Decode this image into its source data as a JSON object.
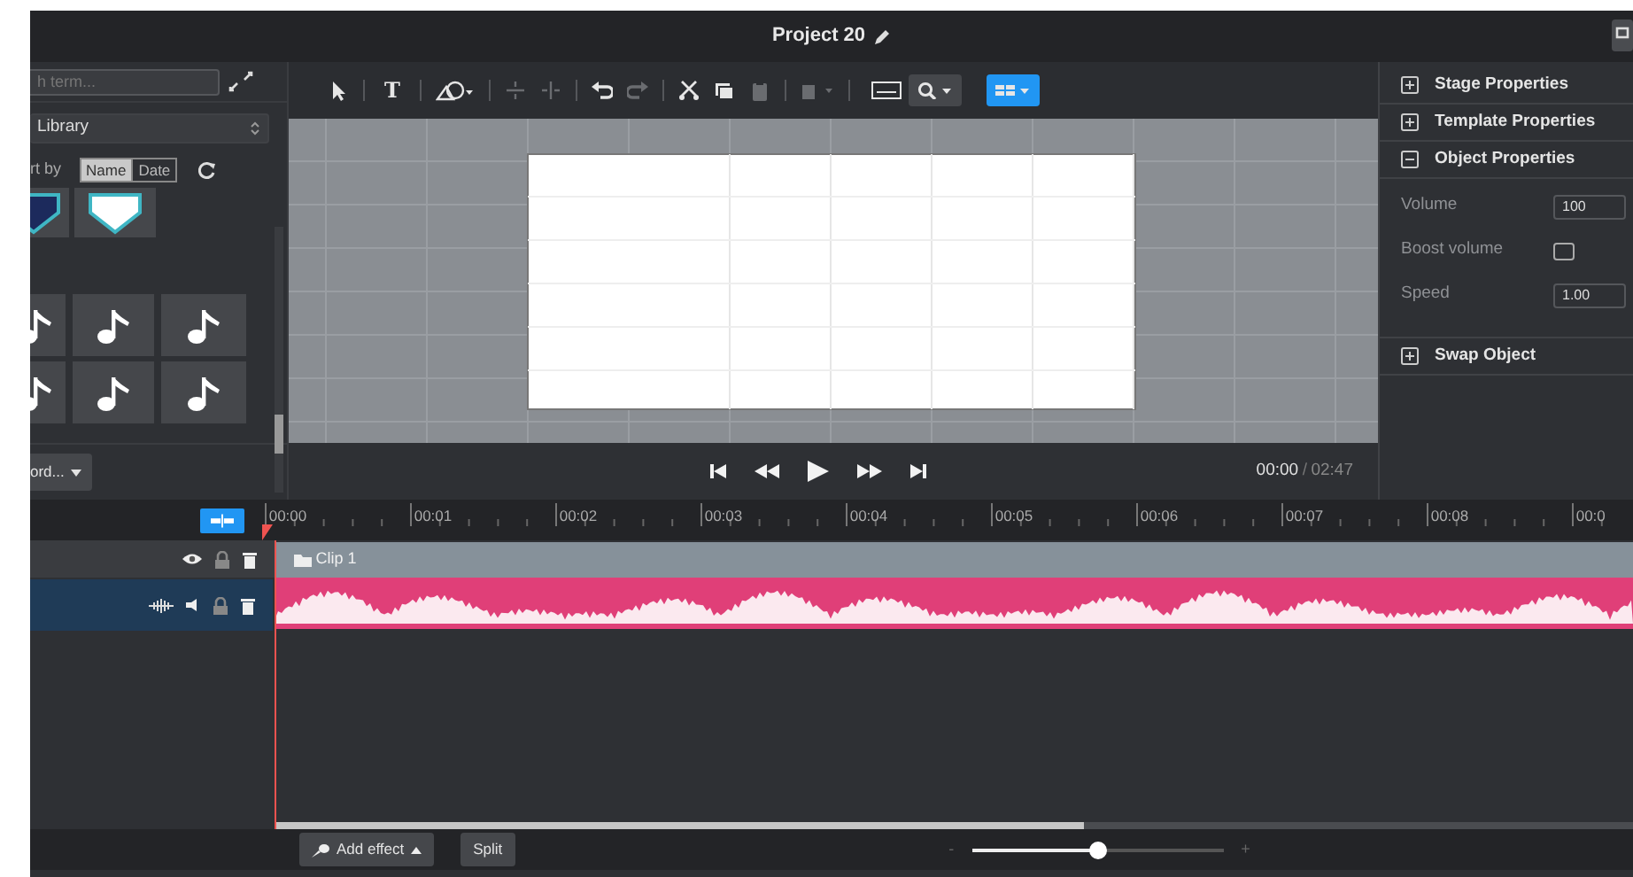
{
  "window": {
    "title": "Project 20"
  },
  "library": {
    "search_placeholder": "h term...",
    "source": "Library",
    "sort_label": "rt by",
    "sort_options": [
      {
        "label": "Name",
        "selected": true
      },
      {
        "label": "Date",
        "selected": false
      }
    ],
    "thumbnails": [
      {
        "kind": "logo",
        "color": "#1c2a5c"
      },
      {
        "kind": "logo",
        "color": "#ffffff"
      },
      {
        "kind": "note"
      },
      {
        "kind": "note"
      },
      {
        "kind": "note"
      },
      {
        "kind": "note"
      },
      {
        "kind": "note"
      },
      {
        "kind": "note"
      }
    ],
    "footer_button": "ord..."
  },
  "toolbar": [
    {
      "kind": "pointer",
      "disabled": false
    },
    {
      "kind": "sep"
    },
    {
      "kind": "text",
      "label": "T",
      "disabled": false
    },
    {
      "kind": "sep"
    },
    {
      "kind": "shape",
      "disabled": false
    },
    {
      "kind": "sep"
    },
    {
      "kind": "alignv",
      "disabled": true
    },
    {
      "kind": "alignh",
      "disabled": true
    },
    {
      "kind": "sep"
    },
    {
      "kind": "undo",
      "disabled": false
    },
    {
      "kind": "redo",
      "disabled": true
    },
    {
      "kind": "sep"
    },
    {
      "kind": "cut",
      "disabled": false
    },
    {
      "kind": "copy",
      "disabled": false
    },
    {
      "kind": "paste",
      "disabled": true
    },
    {
      "kind": "sep"
    },
    {
      "kind": "arrange",
      "disabled": true
    },
    {
      "kind": "sep"
    },
    {
      "kind": "caption",
      "disabled": false
    },
    {
      "kind": "zoom",
      "disabled": false
    },
    {
      "kind": "layout",
      "disabled": false
    }
  ],
  "transport": {
    "current": "00:00",
    "separator": "/",
    "total": "02:47"
  },
  "properties": [
    {
      "title": "Stage Properties",
      "expanded": false
    },
    {
      "title": "Template Properties",
      "expanded": false
    },
    {
      "title": "Object Properties",
      "expanded": true,
      "fields": [
        {
          "kind": "number",
          "label": "Volume",
          "value": "100"
        },
        {
          "kind": "checkbox",
          "label": "Boost volume",
          "checked": false
        },
        {
          "kind": "number",
          "label": "Speed",
          "value": "1.00"
        }
      ]
    },
    {
      "title": "Swap Object",
      "expanded": false
    }
  ],
  "timeline": {
    "ruler": [
      "00:00",
      "00:01",
      "00:02",
      "00:03",
      "00:04",
      "00:05",
      "00:06",
      "00:07",
      "00:08",
      "00:0"
    ],
    "tracks": [
      {
        "kind": "clip",
        "label": "Clip 1",
        "selected": false
      },
      {
        "kind": "audio",
        "selected": true
      }
    ]
  },
  "bottom": {
    "add_effect": "Add effect",
    "split": "Split",
    "zoom": {
      "minus": "-",
      "plus": "+",
      "level": 0.5
    }
  }
}
